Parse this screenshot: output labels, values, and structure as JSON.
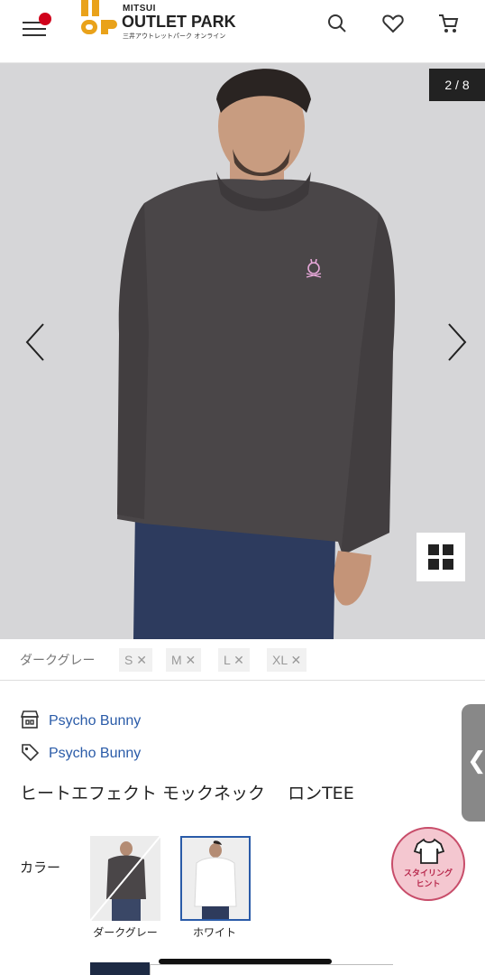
{
  "header": {
    "logo_line1": "MITSUI",
    "logo_line2": "OUTLET PARK",
    "logo_line3": "三井アウトレットパーク オンライン",
    "icons": [
      "menu-icon",
      "search-icon",
      "heart-icon",
      "cart-icon"
    ],
    "notification_color": "#d0021b"
  },
  "gallery": {
    "counter": "2 / 8",
    "prev_icon": "chevron-left-icon",
    "next_icon": "chevron-right-icon",
    "grid_icon": "grid-icon"
  },
  "sizes": {
    "color_name": "ダークグレー",
    "options": [
      "S ✕",
      "M ✕",
      "L ✕",
      "XL ✕"
    ]
  },
  "product": {
    "brand_label": "Psycho Bunny",
    "brand_icon": "store-icon",
    "tag_label": "Psycho Bunny",
    "tag_icon": "tag-icon",
    "title": "ヒートエフェクト モックネック　 ロンTEE",
    "color_label": "カラー",
    "swatches": [
      {
        "caption": "ダークグレー",
        "state": "sold-out"
      },
      {
        "caption": "ホワイト",
        "state": "selected"
      }
    ],
    "accent_color": "#2a5ba8"
  },
  "floating": {
    "side_tab_icon": "chevron-left-icon",
    "styling_hint_line1": "スタイリング",
    "styling_hint_line2": "ヒント"
  }
}
